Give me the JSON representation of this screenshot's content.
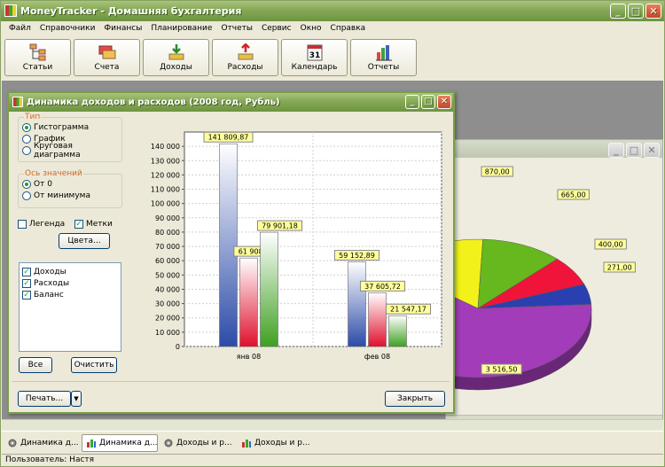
{
  "app": {
    "title": "MoneyTracker - Домашняя бухгалтерия",
    "menu": [
      "Файл",
      "Справочники",
      "Финансы",
      "Планирование",
      "Отчеты",
      "Сервис",
      "Окно",
      "Справка"
    ],
    "toolbar": [
      "Статьи",
      "Счета",
      "Доходы",
      "Расходы",
      "Календарь",
      "Отчеты"
    ],
    "calendar_day": "31"
  },
  "dialog": {
    "title": "Динамика доходов и расходов (2008 год, Рубль)",
    "type_group": {
      "legend": "Тип",
      "options": [
        "Гистограмма",
        "График",
        "Круговая диаграмма"
      ],
      "selected": 0
    },
    "axis_group": {
      "legend": "Ось значений",
      "options": [
        "От 0",
        "От минимума"
      ],
      "selected": 0
    },
    "legend_check": {
      "label": "Легенда",
      "checked": false
    },
    "labels_check": {
      "label": "Метки",
      "checked": true
    },
    "colors_button": "Цвета...",
    "series": [
      {
        "label": "Доходы",
        "checked": true
      },
      {
        "label": "Расходы",
        "checked": true
      },
      {
        "label": "Баланс",
        "checked": true
      }
    ],
    "all_button": "Все",
    "clear_button": "Очистить",
    "print_button": "Печать...",
    "close_button": "Закрыть"
  },
  "chart_data": {
    "type": "bar",
    "categories": [
      "янв 08",
      "фев 08"
    ],
    "series": [
      {
        "values": [
          141809.87,
          59152.89
        ],
        "labels": [
          "141 809,87",
          "59 152,89"
        ]
      },
      {
        "values": [
          61908.0,
          37605.72
        ],
        "labels": [
          "61 908,0",
          "37 605,72"
        ]
      },
      {
        "values": [
          79901.18,
          21547.17
        ],
        "labels": [
          "79 901,18",
          "21 547,17"
        ]
      }
    ],
    "ylim": [
      0,
      150000
    ],
    "yticks": [
      "0",
      "10 000",
      "20 000",
      "30 000",
      "40 000",
      "50 000",
      "60 000",
      "70 000",
      "80 000",
      "90 000",
      "100 000",
      "110 000",
      "120 000",
      "130 000",
      "140 000"
    ],
    "colors": [
      "#2C4BA8",
      "#E0102C",
      "#3FA021"
    ],
    "grid": true
  },
  "pie_chart": {
    "type": "pie",
    "slices": [
      {
        "value": 870.0,
        "label": "870,00",
        "color": "#F2F21A"
      },
      {
        "value": 665.0,
        "label": "665,00",
        "color": "#66B81E"
      },
      {
        "value": 400.0,
        "label": "400,00",
        "color": "#F0143A"
      },
      {
        "value": 271.0,
        "label": "271,00",
        "color": "#2A40B0"
      },
      {
        "value": 3516.5,
        "label": "3 516,50",
        "color": "#A23CB8"
      }
    ]
  },
  "taskbar": [
    "Динамика д...",
    "Динамика д...",
    "Доходы и р...",
    "Доходы и р..."
  ],
  "status": "Пользователь: Настя"
}
